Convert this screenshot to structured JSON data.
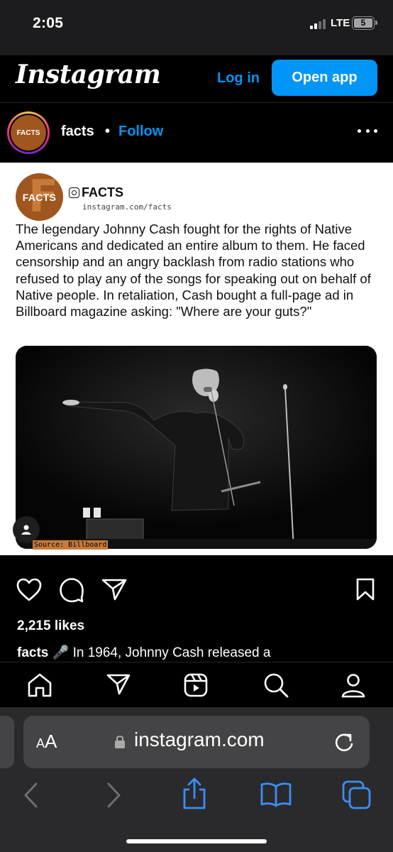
{
  "status_bar": {
    "time": "2:05",
    "network": "LTE",
    "battery": "5"
  },
  "header": {
    "logo": "Instagram",
    "login_label": "Log in",
    "open_app_label": "Open app"
  },
  "profile": {
    "username": "facts",
    "separator": "•",
    "follow_label": "Follow",
    "avatar_text": "FACTS"
  },
  "post": {
    "avatar_text": "FACTS",
    "avatar_letter": "F",
    "handle": "FACTS",
    "url": "instagram.com/facts",
    "text": "The legendary Johnny Cash fought for the rights of Native Americans and dedicated an entire album to them. He faced censorship and an angry backlash from radio stations who refused to play any of the songs for speaking out on behalf of Native people. In retaliation, Cash bought a full-page ad in Billboard magazine asking: \"Where are your guts?\"",
    "source": "Source: Billboard"
  },
  "engagement": {
    "likes": "2,215 likes",
    "caption_user": "facts",
    "caption_emoji": "🎤",
    "caption_text": "In 1964, Johnny Cash released a"
  },
  "safari": {
    "aa_label": "AA",
    "url": "instagram.com"
  },
  "colors": {
    "accent": "#0095f6",
    "brand_orange": "#a0561f",
    "safari_bg": "#2a2a2c",
    "safari_blue": "#3a8ef6"
  }
}
